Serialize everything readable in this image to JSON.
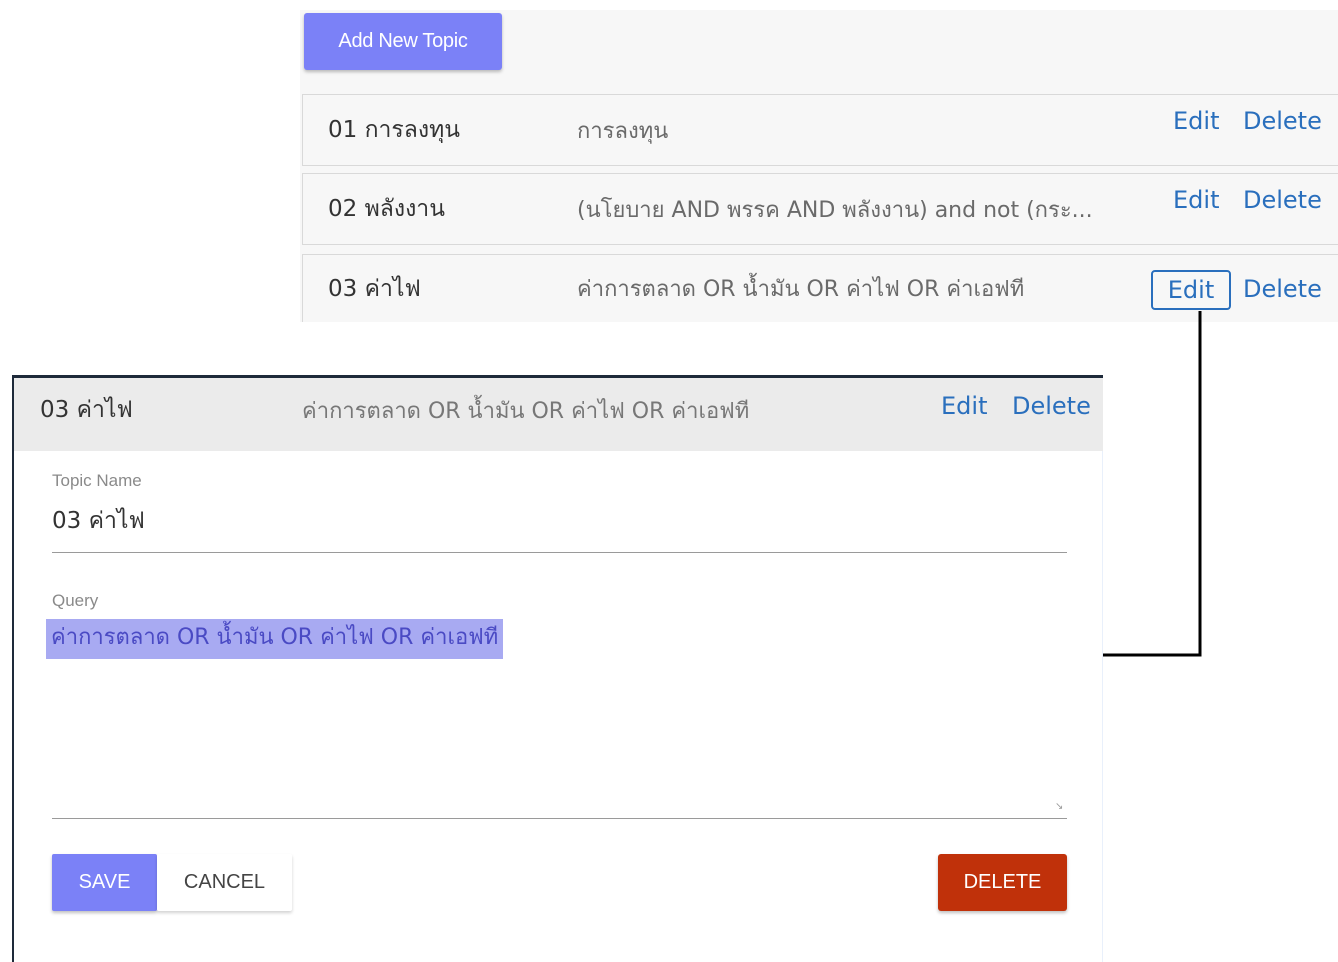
{
  "topic_list": {
    "add_button_label": "Add New Topic",
    "rows": [
      {
        "name": "01 การลงทุน",
        "query": "การลงทุน",
        "edit_label": "Edit",
        "delete_label": "Delete"
      },
      {
        "name": "02 พลังงาน",
        "query": "(นโยบาย AND พรรค AND พลังงาน) and not (กระ...",
        "edit_label": "Edit",
        "delete_label": "Delete"
      },
      {
        "name": "03 ค่าไฟ",
        "query": "ค่าการตลาด OR น้ำมัน OR ค่าไฟ OR ค่าเอฟที",
        "edit_label": "Edit",
        "delete_label": "Delete"
      }
    ]
  },
  "edit_panel": {
    "header": {
      "name": "03 ค่าไฟ",
      "query": "ค่าการตลาด OR น้ำมัน OR ค่าไฟ OR ค่าเอฟที",
      "edit_label": "Edit",
      "delete_label": "Delete"
    },
    "topic_name_label": "Topic Name",
    "topic_name_value": "03 ค่าไฟ",
    "query_label": "Query",
    "query_value": "ค่าการตลาด OR น้ำมัน OR ค่าไฟ OR ค่าเอฟที",
    "save_label": "SAVE",
    "cancel_label": "CANCEL",
    "delete_label": "DELETE"
  },
  "colors": {
    "primary": "#7b81f7",
    "link": "#2a6fbd",
    "danger": "#c0310a",
    "selection": "#a8aaf2"
  }
}
